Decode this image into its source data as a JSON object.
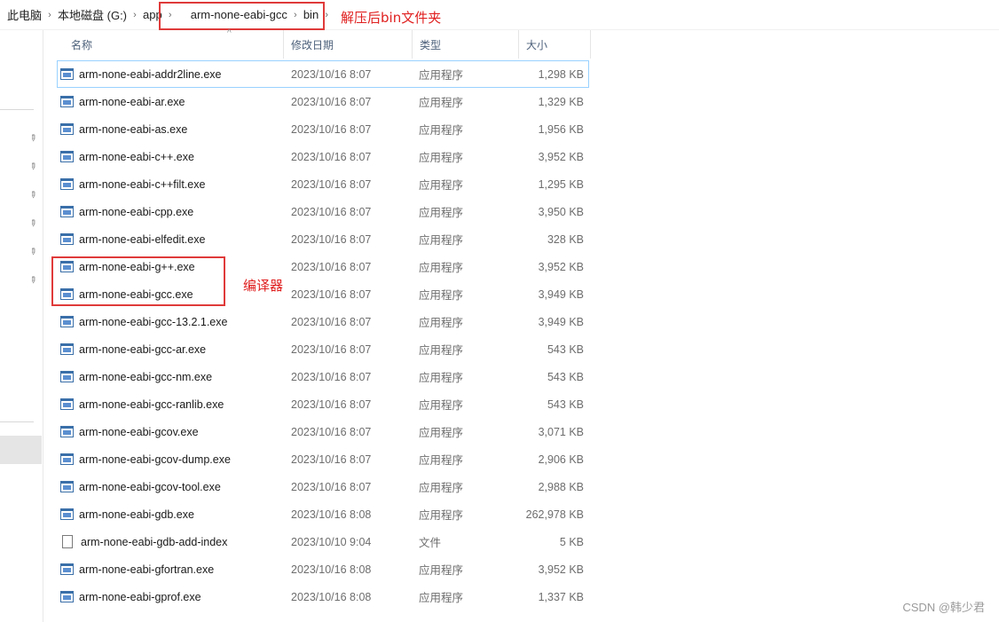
{
  "breadcrumb": {
    "items": [
      "此电脑",
      "本地磁盘 (G:)",
      "app",
      "arm-none-eabi-gcc",
      "bin"
    ],
    "separator": "›"
  },
  "annotations": {
    "bin_note": "解压后bin文件夹",
    "compiler_note": "编译器",
    "color": "#e02020"
  },
  "columns": {
    "name": "名称",
    "date": "修改日期",
    "type": "类型",
    "size": "大小"
  },
  "files": [
    {
      "name": "arm-none-eabi-addr2line.exe",
      "date": "2023/10/16 8:07",
      "type": "应用程序",
      "size": "1,298 KB",
      "icon": "exe-icon"
    },
    {
      "name": "arm-none-eabi-ar.exe",
      "date": "2023/10/16 8:07",
      "type": "应用程序",
      "size": "1,329 KB",
      "icon": "exe-icon"
    },
    {
      "name": "arm-none-eabi-as.exe",
      "date": "2023/10/16 8:07",
      "type": "应用程序",
      "size": "1,956 KB",
      "icon": "exe-icon"
    },
    {
      "name": "arm-none-eabi-c++.exe",
      "date": "2023/10/16 8:07",
      "type": "应用程序",
      "size": "3,952 KB",
      "icon": "exe-icon"
    },
    {
      "name": "arm-none-eabi-c++filt.exe",
      "date": "2023/10/16 8:07",
      "type": "应用程序",
      "size": "1,295 KB",
      "icon": "exe-icon"
    },
    {
      "name": "arm-none-eabi-cpp.exe",
      "date": "2023/10/16 8:07",
      "type": "应用程序",
      "size": "3,950 KB",
      "icon": "exe-icon"
    },
    {
      "name": "arm-none-eabi-elfedit.exe",
      "date": "2023/10/16 8:07",
      "type": "应用程序",
      "size": "328 KB",
      "icon": "exe-icon"
    },
    {
      "name": "arm-none-eabi-g++.exe",
      "date": "2023/10/16 8:07",
      "type": "应用程序",
      "size": "3,952 KB",
      "icon": "exe-icon"
    },
    {
      "name": "arm-none-eabi-gcc.exe",
      "date": "2023/10/16 8:07",
      "type": "应用程序",
      "size": "3,949 KB",
      "icon": "exe-icon"
    },
    {
      "name": "arm-none-eabi-gcc-13.2.1.exe",
      "date": "2023/10/16 8:07",
      "type": "应用程序",
      "size": "3,949 KB",
      "icon": "exe-icon"
    },
    {
      "name": "arm-none-eabi-gcc-ar.exe",
      "date": "2023/10/16 8:07",
      "type": "应用程序",
      "size": "543 KB",
      "icon": "exe-icon"
    },
    {
      "name": "arm-none-eabi-gcc-nm.exe",
      "date": "2023/10/16 8:07",
      "type": "应用程序",
      "size": "543 KB",
      "icon": "exe-icon"
    },
    {
      "name": "arm-none-eabi-gcc-ranlib.exe",
      "date": "2023/10/16 8:07",
      "type": "应用程序",
      "size": "543 KB",
      "icon": "exe-icon"
    },
    {
      "name": "arm-none-eabi-gcov.exe",
      "date": "2023/10/16 8:07",
      "type": "应用程序",
      "size": "3,071 KB",
      "icon": "exe-icon"
    },
    {
      "name": "arm-none-eabi-gcov-dump.exe",
      "date": "2023/10/16 8:07",
      "type": "应用程序",
      "size": "2,906 KB",
      "icon": "exe-icon"
    },
    {
      "name": "arm-none-eabi-gcov-tool.exe",
      "date": "2023/10/16 8:07",
      "type": "应用程序",
      "size": "2,988 KB",
      "icon": "exe-icon"
    },
    {
      "name": "arm-none-eabi-gdb.exe",
      "date": "2023/10/16 8:08",
      "type": "应用程序",
      "size": "262,978 KB",
      "icon": "exe-icon"
    },
    {
      "name": "arm-none-eabi-gdb-add-index",
      "date": "2023/10/10 9:04",
      "type": "文件",
      "size": "5 KB",
      "icon": "file-icon"
    },
    {
      "name": "arm-none-eabi-gfortran.exe",
      "date": "2023/10/16 8:08",
      "type": "应用程序",
      "size": "3,952 KB",
      "icon": "exe-icon"
    },
    {
      "name": "arm-none-eabi-gprof.exe",
      "date": "2023/10/16 8:08",
      "type": "应用程序",
      "size": "1,337 KB",
      "icon": "exe-icon"
    }
  ],
  "watermark": "CSDN @韩少君"
}
